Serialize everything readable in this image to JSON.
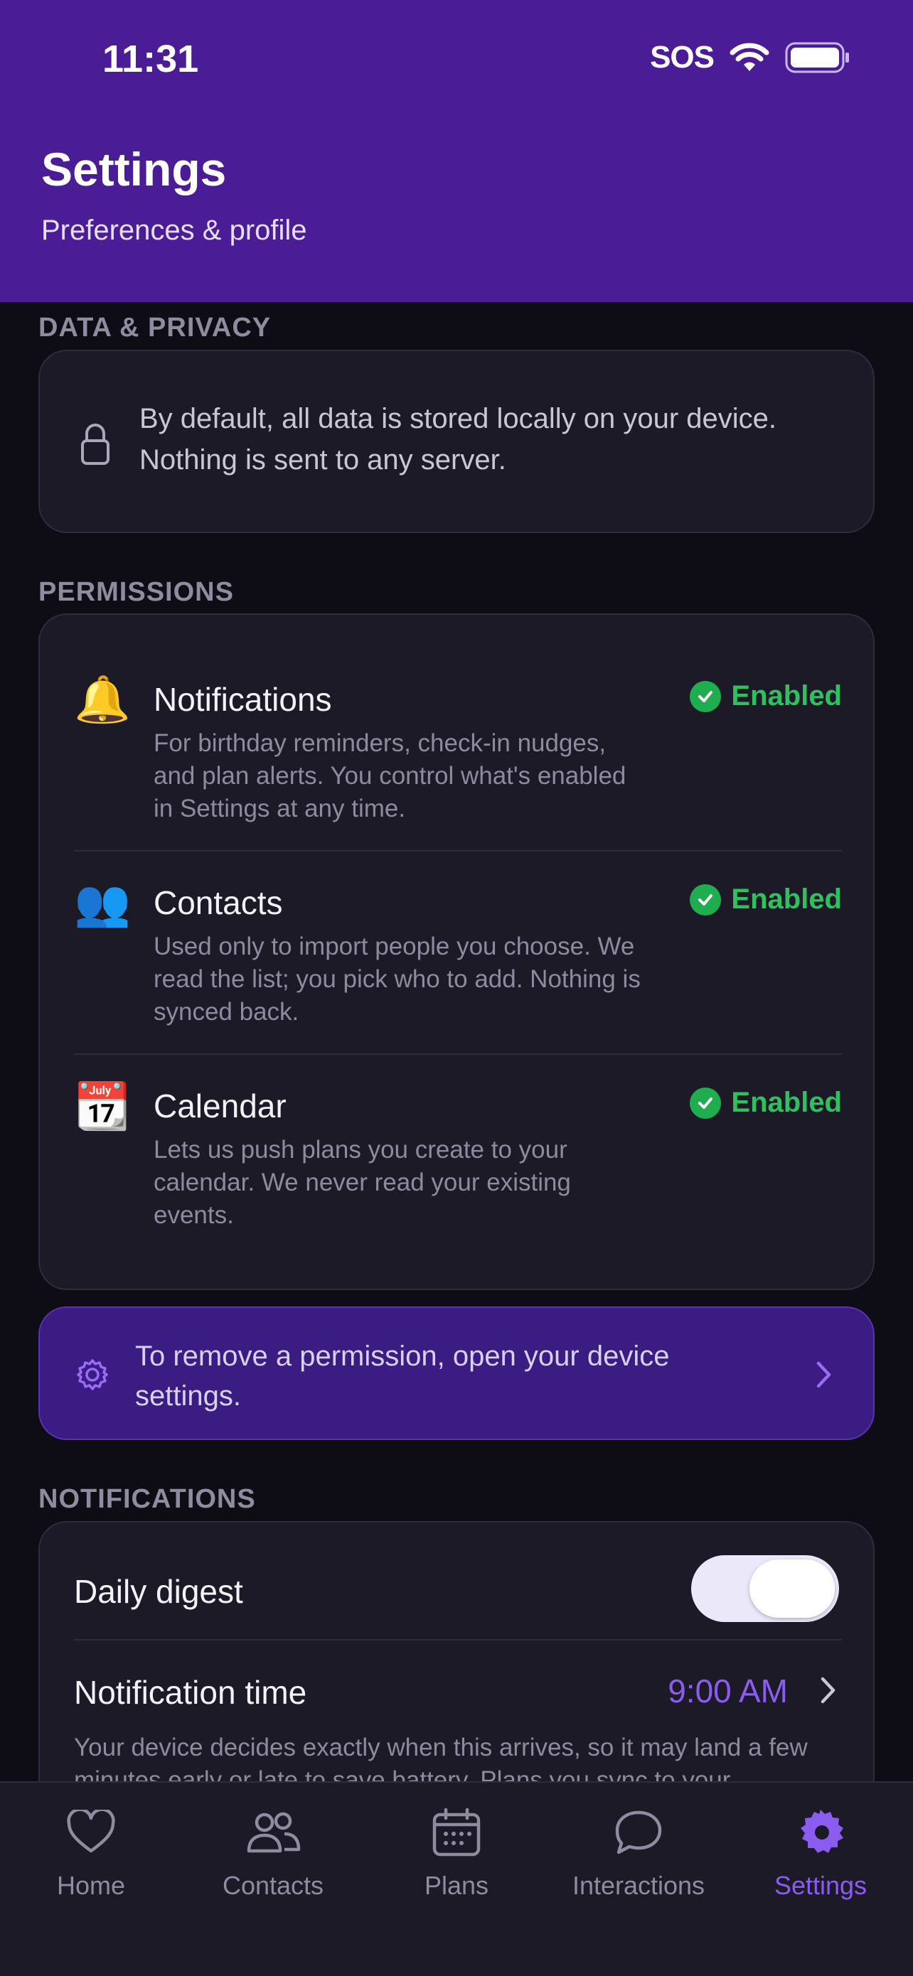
{
  "status_bar": {
    "time": "11:31",
    "sos": "SOS"
  },
  "header": {
    "title": "Settings",
    "subtitle": "Preferences & profile"
  },
  "data_privacy": {
    "section_label": "DATA & PRIVACY",
    "icon": "lock-icon",
    "text": "By default, all data is stored locally on your device. Nothing is sent to any server."
  },
  "permissions": {
    "section_label": "PERMISSIONS",
    "items": [
      {
        "emoji": "🔔",
        "title": "Notifications",
        "status": "Enabled",
        "description": "For birthday reminders, check-in nudges, and plan alerts. You control what's enabled in Settings at any time."
      },
      {
        "emoji": "👥",
        "title": "Contacts",
        "status": "Enabled",
        "description": "Used only to import people you choose. We read the list; you pick who to add. Nothing is synced back."
      },
      {
        "emoji": "📆",
        "title": "Calendar",
        "status": "Enabled",
        "description": "Lets us push plans you create to your calendar. We never read your existing events."
      }
    ],
    "banner_text": "To remove a permission, open your device settings."
  },
  "notifications": {
    "section_label": "NOTIFICATIONS",
    "daily_digest_label": "Daily digest",
    "daily_digest_on": true,
    "time_label": "Notification time",
    "time_value": "9:00 AM",
    "footnote": "Your device decides exactly when this arrives, so it may land a few minutes early or late to save battery. Plans you sync to your"
  },
  "tabs": [
    {
      "label": "Home",
      "icon": "heart-icon",
      "active": false
    },
    {
      "label": "Contacts",
      "icon": "people-icon",
      "active": false
    },
    {
      "label": "Plans",
      "icon": "calendar-icon",
      "active": false
    },
    {
      "label": "Interactions",
      "icon": "chat-bubble-icon",
      "active": false
    },
    {
      "label": "Settings",
      "icon": "gear-icon",
      "active": true
    }
  ],
  "colors": {
    "header": "#4a1c96",
    "accent": "#8b5cf0",
    "enabled": "#2fc05f",
    "background": "#0e0d15",
    "card": "#1b1a26"
  }
}
